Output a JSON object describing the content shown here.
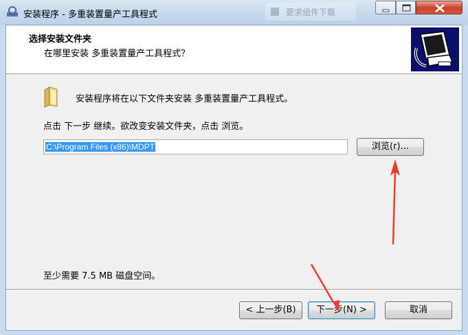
{
  "window": {
    "title": "安装程序 - 多重装置量产工具程式",
    "background_tab_label": "要求组件下载"
  },
  "header": {
    "title": "选择安装文件夹",
    "subtitle": "在哪里安装 多重装置量产工具程式？",
    "logo_icon": "computer-install-icon"
  },
  "main": {
    "intro": "安装程序将在以下文件夹安装 多重装置量产工具程式。",
    "instruction": "点击 下一步 继续。欲改变安装文件夹，点击 浏览。",
    "install_path": "C:\\Program Files (x86)\\MDPT",
    "browse_label": "浏览(r)...",
    "disk_space": "至少需要 7.5 MB 磁盘空间。"
  },
  "footer": {
    "back_label": "< 上一步(B)",
    "next_label": "下一步(N) >",
    "cancel_label": "取消"
  },
  "colors": {
    "annotation_arrow": "#f03a2a",
    "selection": "#3399ff",
    "logo_bg": "#0a0f6b"
  }
}
